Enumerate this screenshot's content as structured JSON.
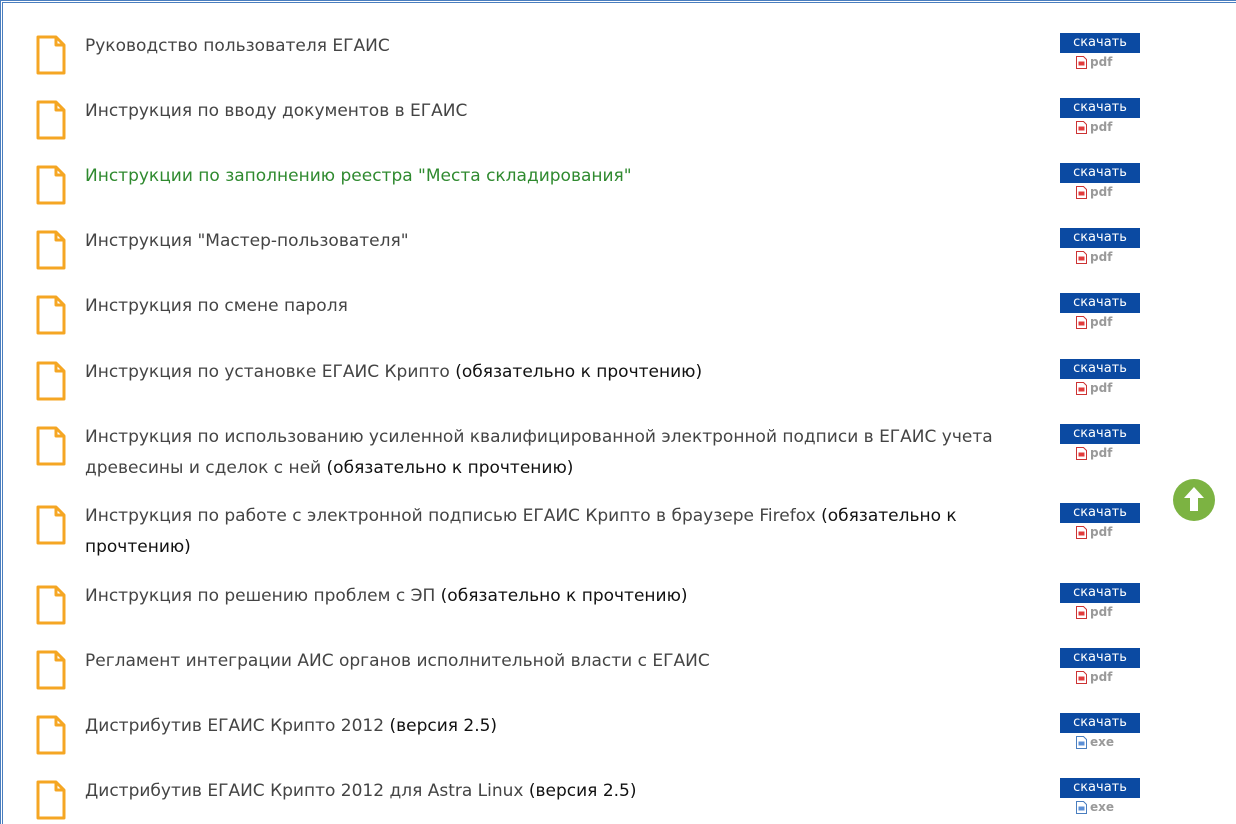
{
  "download_label": "скачать",
  "colors": {
    "button_bg": "#0b4aa2",
    "doc_icon": "#f5a623",
    "link_green": "#2f8a2f",
    "scroll_up": "#7cb342"
  },
  "items": [
    {
      "title": "Руководство пользователя ЕГАИС",
      "note": "",
      "filetype": "pdf"
    },
    {
      "title": "Инструкция по вводу документов в ЕГАИС",
      "note": "",
      "filetype": "pdf"
    },
    {
      "title": "Инструкции по заполнению реестра \"Места складирования\"",
      "note": "",
      "filetype": "pdf",
      "highlight": true
    },
    {
      "title": "Инструкция \"Мастер-пользователя\"",
      "note": "",
      "filetype": "pdf"
    },
    {
      "title": "Инструкция по смене пароля",
      "note": "",
      "filetype": "pdf"
    },
    {
      "title": "Инструкция по установке ЕГАИС Крипто",
      "note": "(обязательно к прочтению)",
      "filetype": "pdf"
    },
    {
      "title": "Инструкция по использованию усиленной квалифицированной электронной подписи в ЕГАИС учета древесины и сделок с ней",
      "note": "(обязательно к прочтению)",
      "filetype": "pdf"
    },
    {
      "title": "Инструкция по работе с электронной подписью ЕГАИС Крипто в браузере Firefox",
      "note": "(обязательно к прочтению)",
      "filetype": "pdf"
    },
    {
      "title": "Инструкция по решению проблем с ЭП",
      "note": "(обязательно к прочтению)",
      "filetype": "pdf"
    },
    {
      "title": "Регламент интеграции АИС органов исполнительной власти с ЕГАИС",
      "note": "",
      "filetype": "pdf"
    },
    {
      "title": "Дистрибутив ЕГАИС Крипто 2012",
      "note": "(версия 2.5)",
      "filetype": "exe"
    },
    {
      "title": "Дистрибутив ЕГАИС Крипто 2012 для Astra Linux",
      "note": "(версия 2.5)",
      "filetype": "exe"
    }
  ]
}
